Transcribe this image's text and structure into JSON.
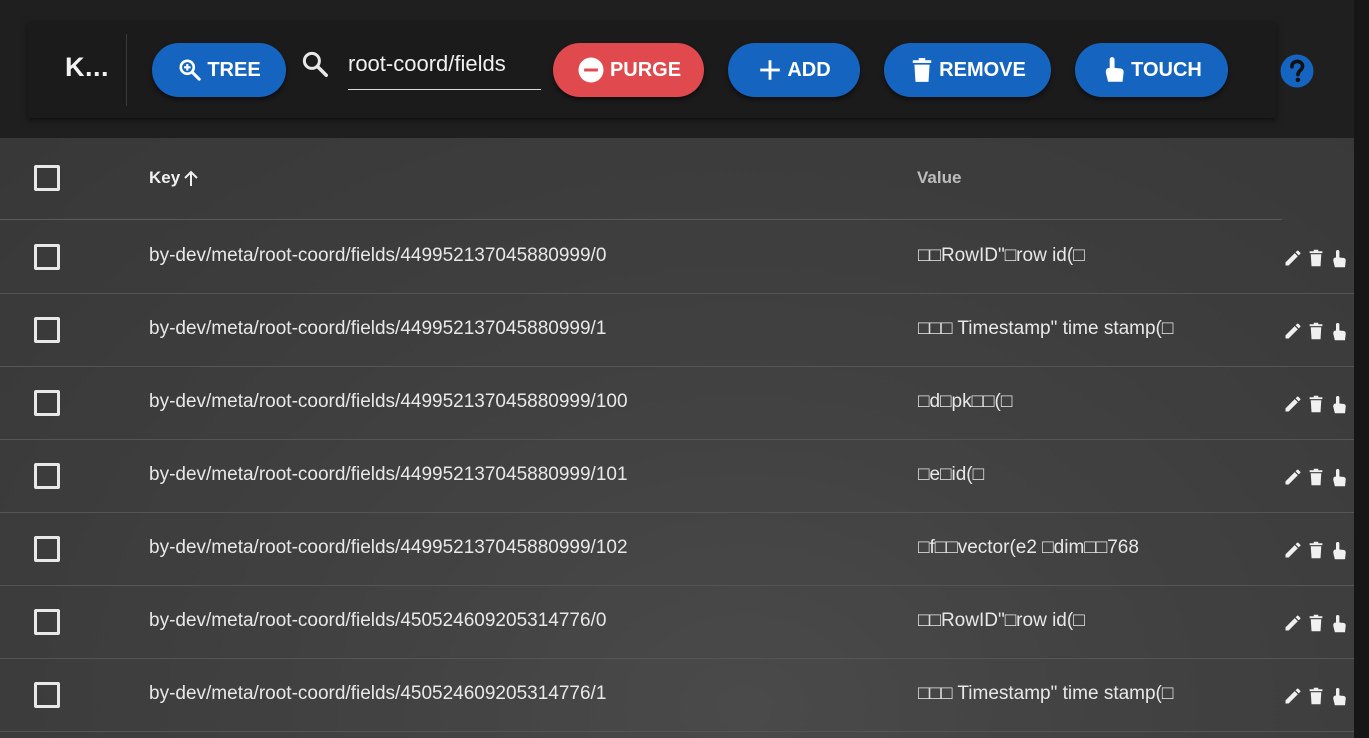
{
  "header": {
    "title": "K..."
  },
  "toolbar": {
    "tree_label": "TREE",
    "purge_label": "PURGE",
    "add_label": "ADD",
    "remove_label": "REMOVE",
    "touch_label": "TOUCH",
    "search_value": "root-coord/fields"
  },
  "colors": {
    "primary": "#1565c0",
    "danger": "#e04a4f",
    "background": "#1f1f1f"
  },
  "icons": {
    "tree": "zoom-in-icon",
    "search": "search-icon",
    "purge": "minus-circle-icon",
    "add": "plus-icon",
    "remove": "trash-icon",
    "touch": "touch-icon",
    "help": "help-icon",
    "sort": "arrow-up-icon",
    "edit": "pencil-icon",
    "delete": "trash-icon",
    "row_touch": "touch-icon"
  },
  "table": {
    "columns": {
      "key": "Key",
      "value": "Value"
    },
    "sort": "Key ascending",
    "rows": [
      {
        "key": "by-dev/meta/root-coord/fields/449952137045880999/0",
        "value": "□□RowID\"□row id(□"
      },
      {
        "key": "by-dev/meta/root-coord/fields/449952137045880999/1",
        "value": "□□□ Timestamp\" time stamp(□"
      },
      {
        "key": "by-dev/meta/root-coord/fields/449952137045880999/100",
        "value": "□d□pk□□(□"
      },
      {
        "key": "by-dev/meta/root-coord/fields/449952137045880999/101",
        "value": "□e□id(□"
      },
      {
        "key": "by-dev/meta/root-coord/fields/449952137045880999/102",
        "value": "□f□□vector(e2 □dim□□768"
      },
      {
        "key": "by-dev/meta/root-coord/fields/450524609205314776/0",
        "value": "□□RowID\"□row id(□"
      },
      {
        "key": "by-dev/meta/root-coord/fields/450524609205314776/1",
        "value": "□□□ Timestamp\" time stamp(□"
      }
    ]
  }
}
